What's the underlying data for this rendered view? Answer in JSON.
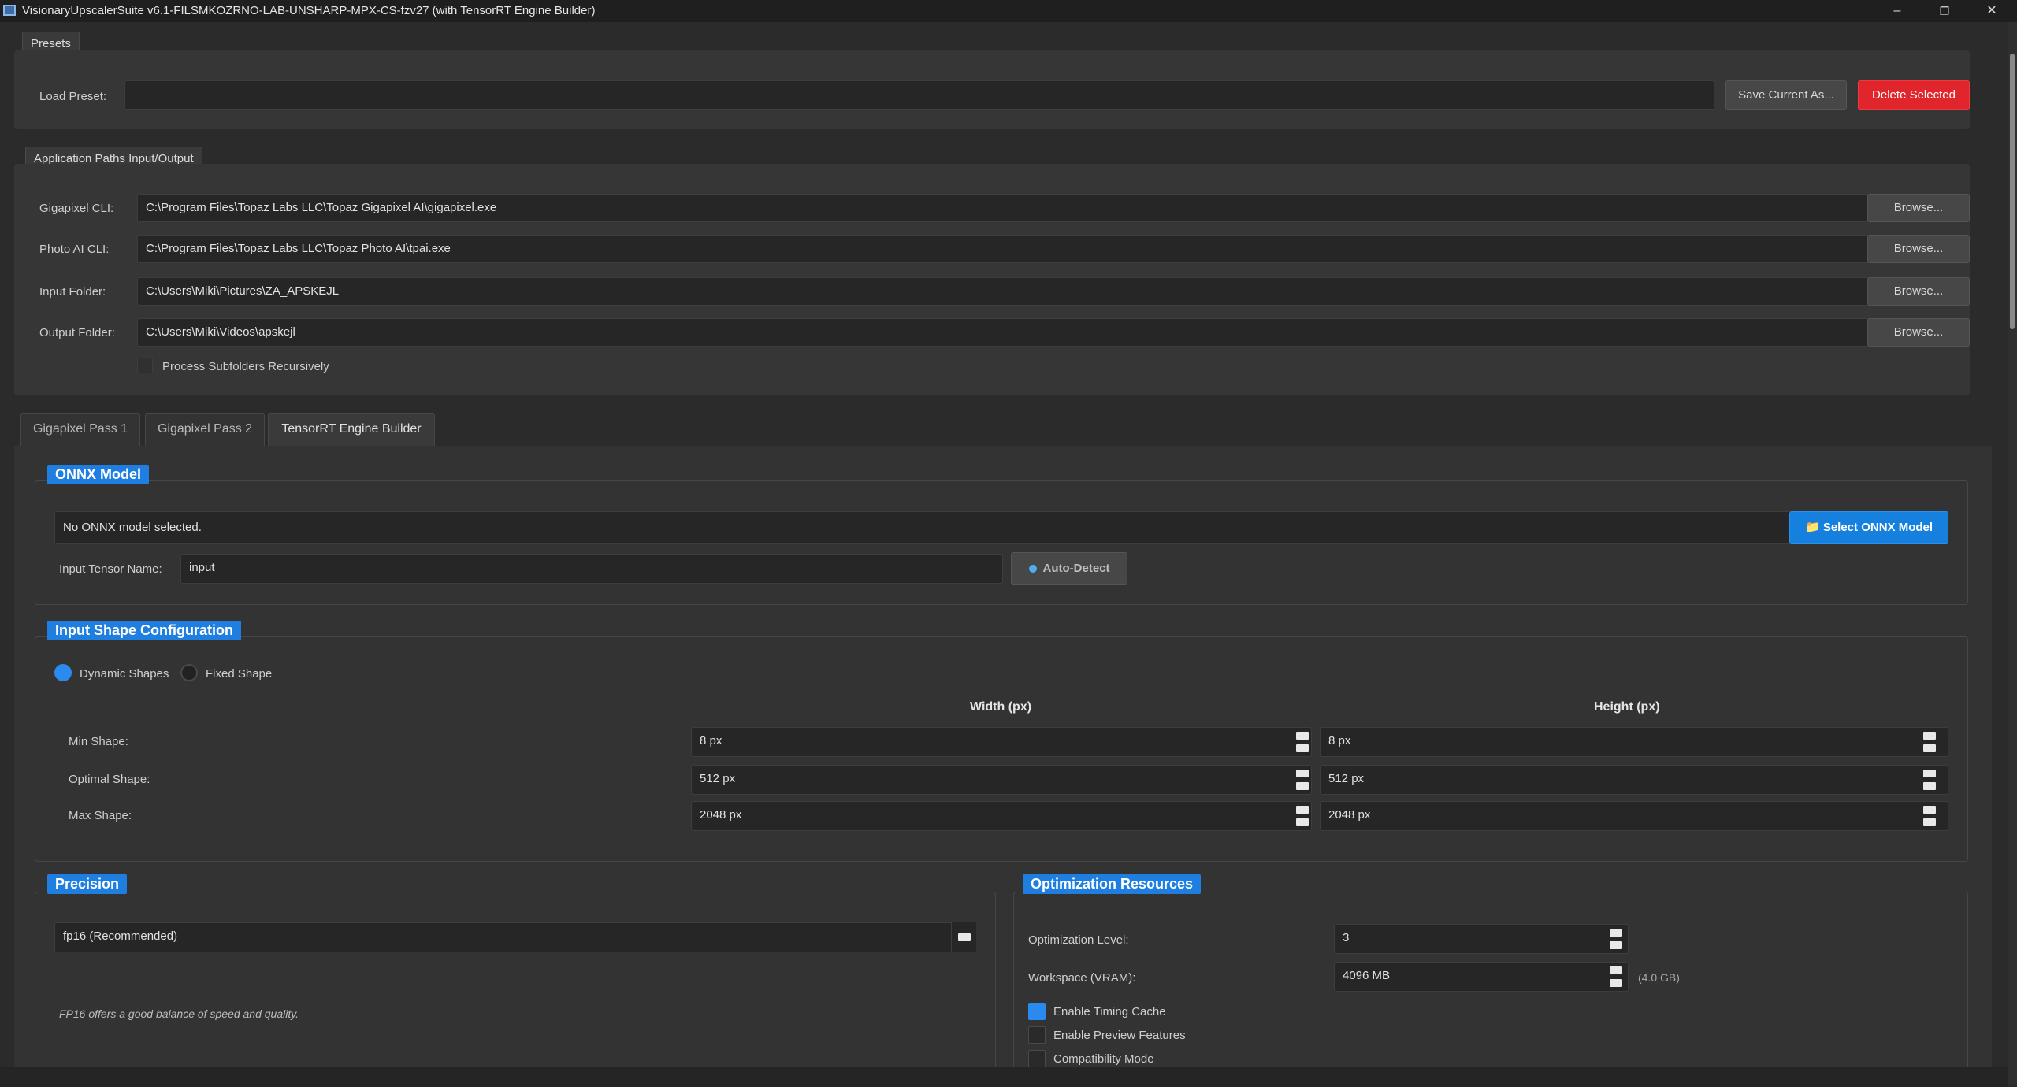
{
  "window": {
    "title": "VisionaryUpscalerSuite v6.1-FILSMKOZRNO-LAB-UNSHARP-MPX-CS-fzv27 (with TensorRT Engine Builder)",
    "minimize": "–",
    "restore": "❐",
    "close": "✕"
  },
  "presets": {
    "tab_label": "Presets",
    "load_label": "Load Preset:",
    "load_value": "",
    "save_button": "Save Current As...",
    "delete_button": "Delete Selected",
    "colors": {
      "delete": "#e0262c"
    }
  },
  "paths": {
    "tab_label": "Application Paths  Input/Output",
    "rows": [
      {
        "label": "Gigapixel CLI:",
        "value": "C:\\Program Files\\Topaz Labs LLC\\Topaz Gigapixel AI\\gigapixel.exe",
        "button": "Browse..."
      },
      {
        "label": "Photo AI CLI:",
        "value": "C:\\Program Files\\Topaz Labs LLC\\Topaz Photo AI\\tpai.exe",
        "button": "Browse..."
      },
      {
        "label": "Input Folder:",
        "value": "C:\\Users\\Miki\\Pictures\\ZA_APSKEJL",
        "button": "Browse..."
      },
      {
        "label": "Output Folder:",
        "value": "C:\\Users\\Miki\\Videos\\apskejl",
        "button": "Browse..."
      }
    ],
    "recursive_label": "Process Subfolders Recursively",
    "recursive_checked": false
  },
  "tabs": [
    {
      "label": "Gigapixel Pass 1",
      "active": false
    },
    {
      "label": "Gigapixel Pass 2",
      "active": false
    },
    {
      "label": "TensorRT Engine Builder",
      "active": true
    }
  ],
  "onnx": {
    "title": "ONNX Model",
    "model_status": "No ONNX model selected.",
    "select_button": "Select ONNX Model",
    "folder_icon": "folder-icon",
    "tensor_label": "Input Tensor Name:",
    "tensor_value": "input",
    "autodetect_button": "Auto-Detect"
  },
  "shape": {
    "title": "Input Shape Configuration",
    "dynamic_label": "Dynamic Shapes",
    "fixed_label": "Fixed Shape",
    "selected": "dynamic",
    "width_header": "Width (px)",
    "height_header": "Height (px)",
    "rows": [
      {
        "label": "Min Shape:",
        "width": "8 px",
        "height": "8 px"
      },
      {
        "label": "Optimal Shape:",
        "width": "512 px",
        "height": "512 px"
      },
      {
        "label": "Max Shape:",
        "width": "2048 px",
        "height": "2048 px"
      }
    ]
  },
  "precision": {
    "title": "Precision",
    "value": "fp16 (Recommended)",
    "note": "FP16 offers a good balance of speed and quality."
  },
  "optimization": {
    "title": "Optimization  Resources",
    "level_label": "Optimization Level:",
    "level_value": "3",
    "workspace_label": "Workspace (VRAM):",
    "workspace_value": "4096 MB",
    "workspace_hint": "(4.0 GB)",
    "options": [
      {
        "label": "Enable Timing Cache",
        "checked": true
      },
      {
        "label": "Enable Preview Features",
        "checked": false
      },
      {
        "label": "Compatibility Mode",
        "checked": false
      }
    ]
  },
  "colors": {
    "accent": "#1f7fe0",
    "background": "#2b2b2b"
  }
}
